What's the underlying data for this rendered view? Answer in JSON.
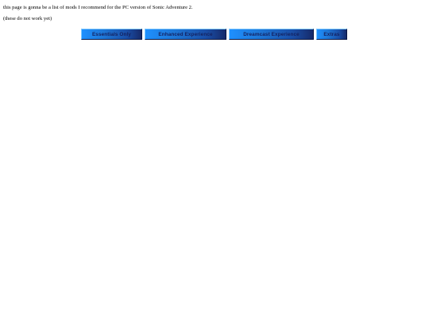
{
  "page": {
    "intro_text": "this page is gonna be a list of mods I recommend for the PC version of Sonic Adventure 2.",
    "note_text": "(these do not work yet)"
  },
  "buttons": [
    {
      "label": "Essentials Only"
    },
    {
      "label": "Enhanced Experience"
    },
    {
      "label": "Dreamcast Experience"
    },
    {
      "label": "Extras"
    }
  ],
  "colors": {
    "button_gradient_start": "#1e90ff",
    "button_gradient_end": "#162a6a",
    "button_text": "#14215f"
  }
}
